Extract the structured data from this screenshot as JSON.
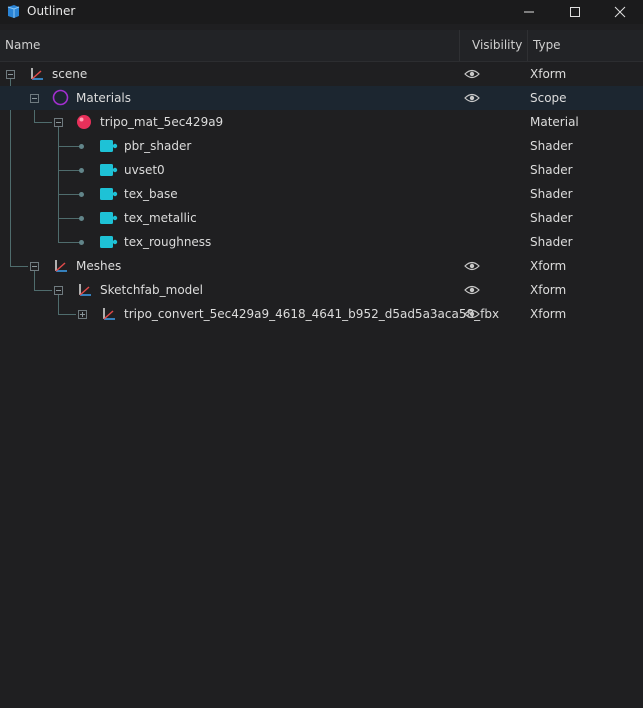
{
  "window": {
    "title": "Outliner"
  },
  "columns": {
    "name": "Name",
    "visibility": "Visibility",
    "type": "Type"
  },
  "rows": [
    {
      "label": "scene",
      "type": "Xform",
      "icon": "xform-axes-icon",
      "visible": true
    },
    {
      "label": "Materials",
      "type": "Scope",
      "icon": "scope-circle-icon",
      "visible": true,
      "selected": true
    },
    {
      "label": "tripo_mat_5ec429a9",
      "type": "Material",
      "icon": "material-sphere-icon",
      "visible": false
    },
    {
      "label": "pbr_shader",
      "type": "Shader",
      "icon": "shader-icon",
      "visible": false
    },
    {
      "label": "uvset0",
      "type": "Shader",
      "icon": "shader-icon",
      "visible": false
    },
    {
      "label": "tex_base",
      "type": "Shader",
      "icon": "shader-icon",
      "visible": false
    },
    {
      "label": "tex_metallic",
      "type": "Shader",
      "icon": "shader-icon",
      "visible": false
    },
    {
      "label": "tex_roughness",
      "type": "Shader",
      "icon": "shader-icon",
      "visible": false
    },
    {
      "label": "Meshes",
      "type": "Xform",
      "icon": "xform-axes-icon",
      "visible": true
    },
    {
      "label": "Sketchfab_model",
      "type": "Xform",
      "icon": "xform-axes-icon",
      "visible": true
    },
    {
      "label": "tripo_convert_5ec429a9_4618_4641_b952_d5ad5a3aca58_fbx",
      "type": "Xform",
      "icon": "xform-axes-icon",
      "visible": true
    }
  ],
  "colors": {
    "selected_row": "#1c2630",
    "shader": "#1ec2d6",
    "scope": "#a22fcf",
    "material": "#e8305a"
  }
}
